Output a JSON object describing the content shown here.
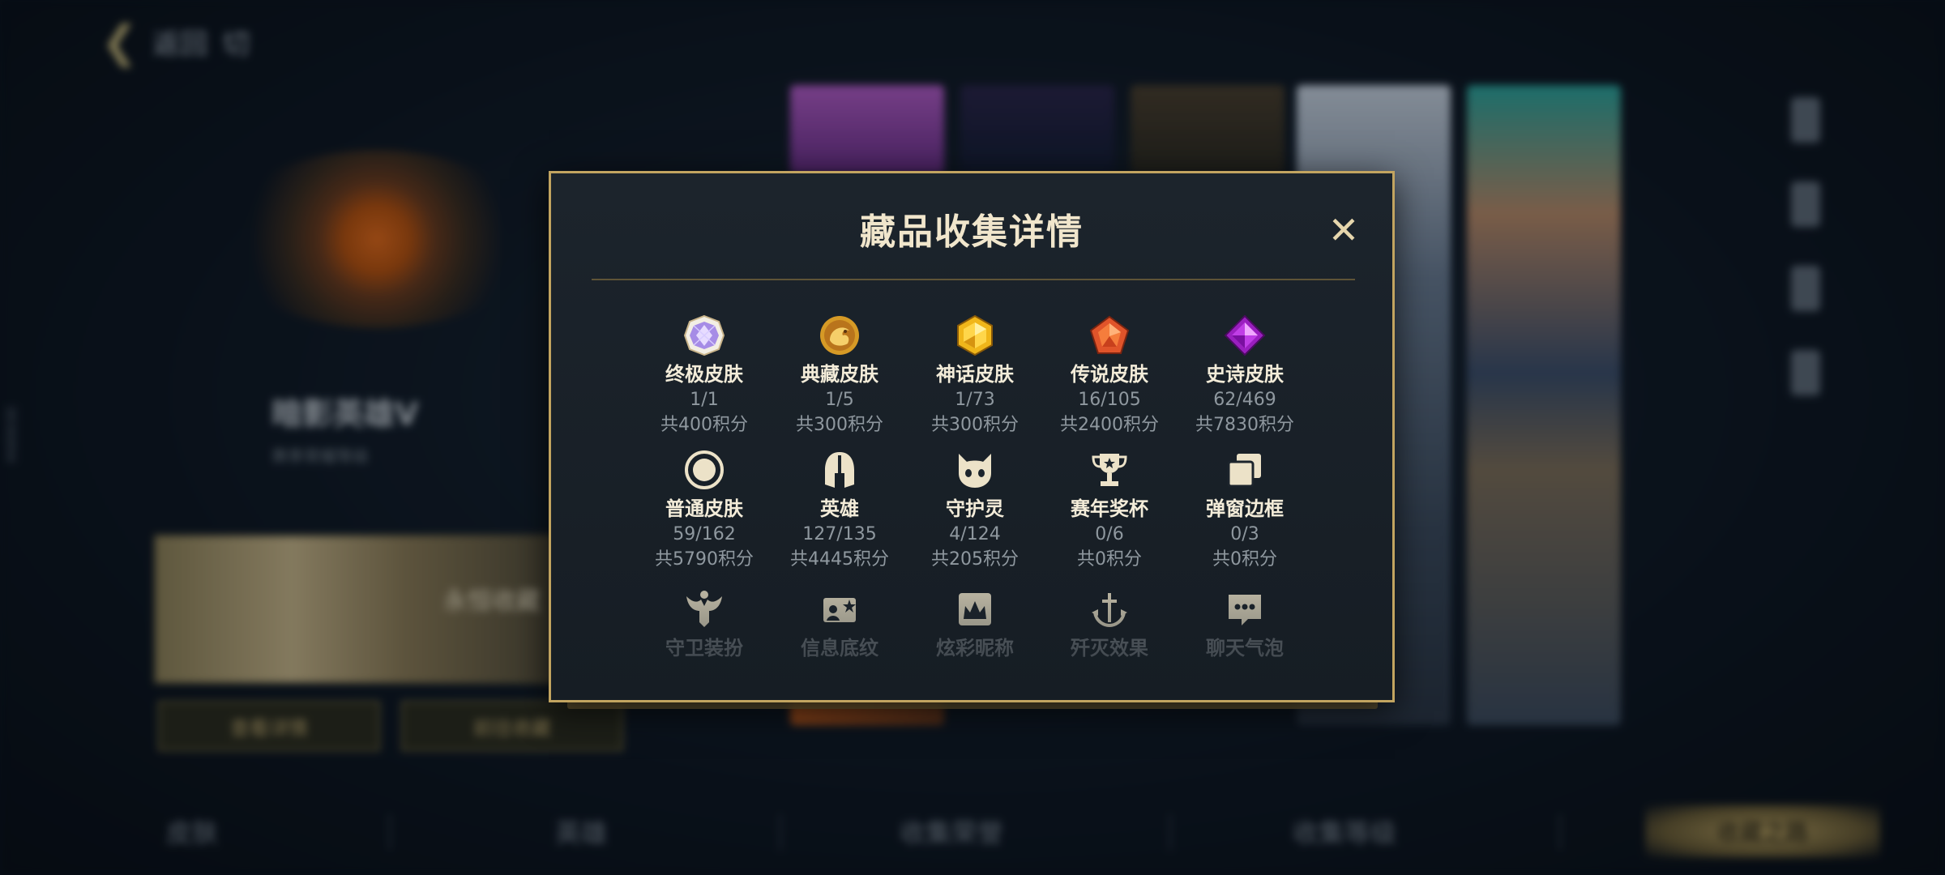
{
  "background": {
    "back_label": "返回",
    "back_extra": "切",
    "side_id": "3836894",
    "player_name": "暗影英雄V",
    "player_subtitle": "赛季荣耀等级",
    "banner_text": "永恒收藏",
    "buttons": [
      "查看详情",
      "前往收藏"
    ],
    "bottom_tabs": [
      "皮肤",
      "英雄",
      "收集荣誉",
      "收集等级"
    ],
    "bottom_button": "收藏之路"
  },
  "modal": {
    "title": "藏品收集详情",
    "close_icon": "close-icon",
    "items": [
      {
        "label": "终极皮肤",
        "count": "1/1",
        "points": "共400积分",
        "icon": "ultimate-skin-icon"
      },
      {
        "label": "典藏皮肤",
        "count": "1/5",
        "points": "共300积分",
        "icon": "collection-skin-icon"
      },
      {
        "label": "神话皮肤",
        "count": "1/73",
        "points": "共300积分",
        "icon": "mythic-skin-icon"
      },
      {
        "label": "传说皮肤",
        "count": "16/105",
        "points": "共2400积分",
        "icon": "legendary-skin-icon"
      },
      {
        "label": "史诗皮肤",
        "count": "62/469",
        "points": "共7830积分",
        "icon": "epic-skin-icon"
      },
      {
        "label": "普通皮肤",
        "count": "59/162",
        "points": "共5790积分",
        "icon": "normal-skin-icon"
      },
      {
        "label": "英雄",
        "count": "127/135",
        "points": "共4445积分",
        "icon": "hero-helmet-icon"
      },
      {
        "label": "守护灵",
        "count": "4/124",
        "points": "共205积分",
        "icon": "guardian-spirit-icon"
      },
      {
        "label": "赛年奖杯",
        "count": "0/6",
        "points": "共0积分",
        "icon": "trophy-icon"
      },
      {
        "label": "弹窗边框",
        "count": "0/3",
        "points": "共0积分",
        "icon": "popup-frame-icon"
      },
      {
        "label": "守卫装扮",
        "icon": "guard-costume-icon"
      },
      {
        "label": "信息底纹",
        "icon": "info-pattern-icon"
      },
      {
        "label": "炫彩昵称",
        "icon": "colorful-nickname-icon"
      },
      {
        "label": "歼灭效果",
        "icon": "annihilation-effect-icon"
      },
      {
        "label": "聊天气泡",
        "icon": "chat-bubble-icon"
      }
    ]
  },
  "colors": {
    "accent_gold": "#c2a460",
    "title": "#f1e6cc",
    "muted": "#8f989f"
  }
}
